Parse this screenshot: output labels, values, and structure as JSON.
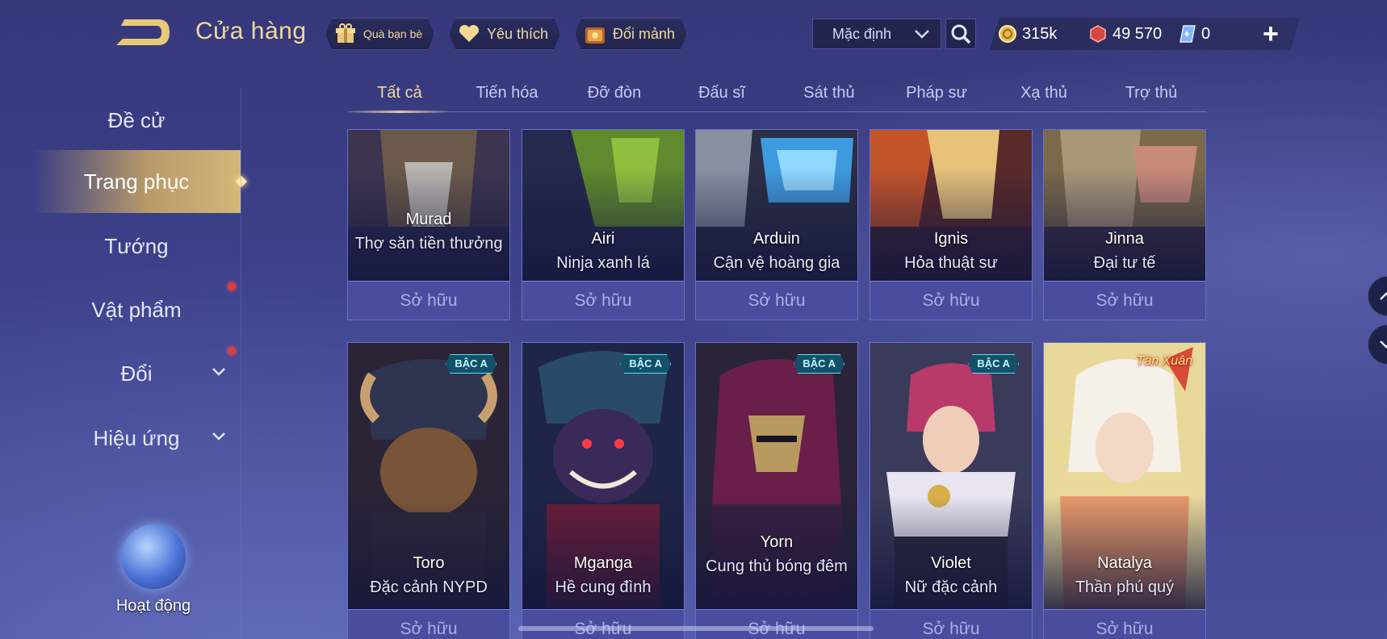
{
  "header": {
    "title": "Cửa hàng",
    "buttons": [
      {
        "label": "Quà bạn bè",
        "icon": "gift-icon"
      },
      {
        "label": "Yêu thích",
        "icon": "heart-icon"
      },
      {
        "label": "Đổi mảnh",
        "icon": "shard-chest-icon"
      }
    ],
    "sort_value": "Mặc định",
    "currency": [
      {
        "value": "315k",
        "icon": "gold-coin-icon"
      },
      {
        "value": "49 570",
        "icon": "red-voucher-icon"
      },
      {
        "value": "0",
        "icon": "diamond-ticket-icon"
      }
    ]
  },
  "sidebar": {
    "items": [
      {
        "label": "Đề cử",
        "active": false
      },
      {
        "label": "Trang phục",
        "active": true
      },
      {
        "label": "Tướng",
        "active": false
      },
      {
        "label": "Vật phẩm",
        "active": false,
        "notification": true
      },
      {
        "label": "Đổi",
        "active": false,
        "notification": true,
        "expandable": true
      },
      {
        "label": "Hiệu ứng",
        "active": false,
        "expandable": true
      }
    ],
    "activity_label": "Hoạt động"
  },
  "tabs": [
    "Tất cả",
    "Tiến hóa",
    "Đỡ đòn",
    "Đấu sĩ",
    "Sát thủ",
    "Pháp sư",
    "Xạ thủ",
    "Trợ thủ"
  ],
  "active_tab": "Tất cả",
  "owned_label": "Sở hữu",
  "cards_row1": [
    {
      "hero": "Murad",
      "skin": "Thợ săn tiền thưởng"
    },
    {
      "hero": "Airi",
      "skin": "Ninja xanh lá"
    },
    {
      "hero": "Arduin",
      "skin": "Cận vệ hoàng gia"
    },
    {
      "hero": "Ignis",
      "skin": "Hỏa thuật sư"
    },
    {
      "hero": "Jinna",
      "skin": "Đại tư tế"
    }
  ],
  "cards_row2": [
    {
      "hero": "Toro",
      "skin": "Đặc cảnh NYPD",
      "tier": "BẬC A"
    },
    {
      "hero": "Mganga",
      "skin": "Hề cung đình",
      "tier": "BẬC A"
    },
    {
      "hero": "Yorn",
      "skin": "Cung thủ bóng đêm",
      "tier": "BẬC A"
    },
    {
      "hero": "Violet",
      "skin": "Nữ đặc cảnh",
      "tier": "BẬC A"
    },
    {
      "hero": "Natalya",
      "skin": "Thần phú quý",
      "event_tag": "Tân Xuân"
    }
  ]
}
